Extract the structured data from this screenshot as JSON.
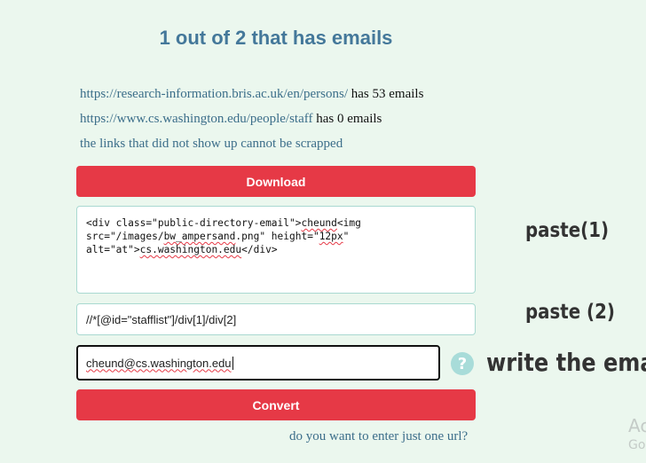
{
  "header": {
    "title": "1 out of 2 that has emails"
  },
  "results": [
    {
      "url": "https://research-information.bris.ac.uk/en/persons/",
      "suffix": "has 53 emails"
    },
    {
      "url": "https://www.cs.washington.edu/people/staff",
      "suffix": "has 0 emails"
    }
  ],
  "note": "the links that did not show up cannot be scrapped",
  "buttons": {
    "download_label": "Download",
    "convert_label": "Convert"
  },
  "fields": {
    "html_snippet_part1": "<div class=\"public-directory-email\">",
    "html_snippet_word1": "cheund",
    "html_snippet_tag": "<img",
    "html_snippet_part2": "\nsrc=\"/images/",
    "html_snippet_file": "bw_ampersand",
    "html_snippet_part3": ".png\" height=\"",
    "html_snippet_height": "12px",
    "html_snippet_part4": "\"\nalt=\"at\">",
    "html_snippet_domain": "cs.washington.edu",
    "html_snippet_part5": "</div>",
    "xpath_value": "//*[@id=\"stafflist\"]/div[1]/div[2]",
    "email_value": "cheund@cs.washington.edu"
  },
  "labels": {
    "paste1": "paste(1)",
    "paste2": "paste (2)",
    "write_email": "write the email",
    "help_symbol": "?"
  },
  "links": {
    "single_url": "do you want to enter just one url?"
  },
  "watermark": {
    "line1": "Ac",
    "line2": "Go"
  },
  "colors": {
    "background": "#ebf7ee",
    "title": "#44789a",
    "button": "#e63946",
    "link_text": "#3c6e8a",
    "help_icon": "#a8dcd9"
  }
}
